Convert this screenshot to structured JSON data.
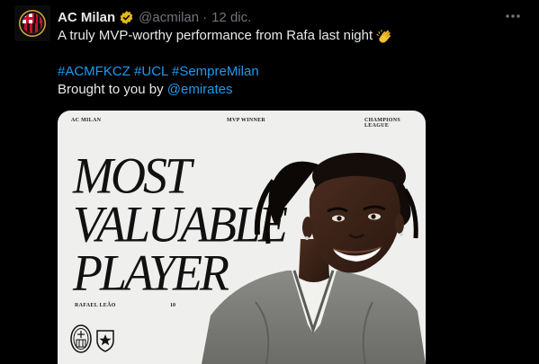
{
  "tweet": {
    "author_name": "AC Milan",
    "handle": "@acmilan",
    "separator": "·",
    "date": "12 dic.",
    "text_line1": "A truly MVP-worthy performance from Rafa last night",
    "hashtags": [
      "#ACMFKCZ",
      "#UCL",
      "#SempreMilan"
    ],
    "brought_by": "Brought to you by",
    "mention": "@emirates"
  },
  "icons": {
    "verified": "verified-badge-icon",
    "more": "more-horizontal-icon",
    "clap": "clapping-hands-emoji"
  },
  "media": {
    "top_left": "AC MILAN",
    "top_center": "MVP WINNER",
    "top_right": "CHAMPIONS LEAGUE",
    "headline": [
      "MOST",
      "VALUABLE",
      "PLAYER"
    ],
    "player_name": "RAFAEL LEÃO",
    "player_number": "10"
  },
  "colors": {
    "background": "#000000",
    "text": "#e7e9ea",
    "muted": "#71767b",
    "link": "#1d9bf0",
    "verified_gold": "#e2b719",
    "milan_red": "#c8102e"
  }
}
